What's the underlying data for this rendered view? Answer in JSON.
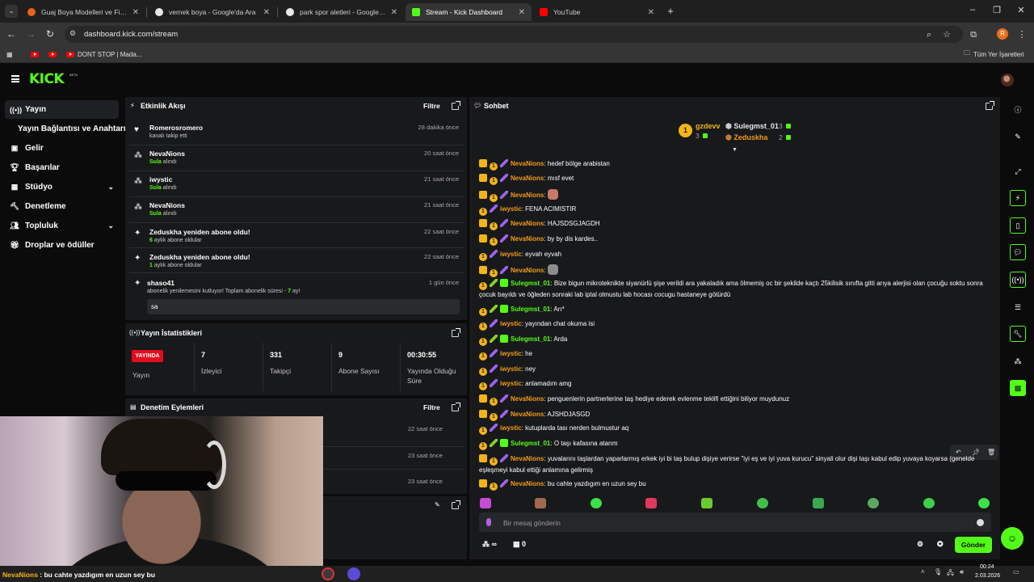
{
  "browser": {
    "tabs": [
      {
        "title": "Guaj Boya Modelleri ve Fiyatları",
        "favicon_color": "#e8631c"
      },
      {
        "title": "vernek boya - Google'da Ara",
        "favicon_color": "#e8e8e8"
      },
      {
        "title": "park spor aletleri - Google'da Ara",
        "favicon_color": "#e8e8e8"
      },
      {
        "title": "Stream - Kick Dashboard",
        "favicon_color": "#53fc18"
      },
      {
        "title": "YouTube",
        "favicon_color": "#ff0000"
      }
    ],
    "url": "dashboard.kick.com/stream",
    "profile_initial": "R",
    "bookmarks": {
      "item": "DONT STOP | Mada...",
      "all_label": "Tüm Yer İşaretleri"
    }
  },
  "app": {
    "logo": "KICK",
    "logo_badge": "BETA",
    "accent": "#53fc18"
  },
  "sidebar": {
    "items": [
      {
        "label": "Yayın",
        "icon": "broadcast-icon"
      },
      {
        "label": "Yayın Bağlantısı ve Anahtarı"
      },
      {
        "label": "Gelir",
        "icon": "revenue-icon"
      },
      {
        "label": "Başarılar",
        "icon": "trophy-icon"
      },
      {
        "label": "Stüdyo",
        "icon": "studio-icon"
      },
      {
        "label": "Denetleme",
        "icon": "hammer-icon"
      },
      {
        "label": "Topluluk",
        "icon": "community-icon"
      },
      {
        "label": "Droplar ve ödüller",
        "icon": "drops-icon"
      }
    ]
  },
  "activity": {
    "title": "Etkinlik Akışı",
    "filter": "Filtre",
    "events": [
      {
        "name": "Romerosromero",
        "sub": "kanalı takip etti",
        "time": "28 dakika önce",
        "icon": "heart-icon"
      },
      {
        "name": "NevaNions",
        "sub_hl": "Sula",
        "sub": " alındı",
        "time": "20 saat önce",
        "icon": "drops-icon"
      },
      {
        "name": "iwystic",
        "sub_hl": "Sula",
        "sub": " alındı",
        "time": "21 saat önce",
        "icon": "drops-icon"
      },
      {
        "name": "NevaNions",
        "sub_hl": "Sula",
        "sub": " alındı",
        "time": "21 saat önce",
        "icon": "drops-icon"
      },
      {
        "name": "Zeduskha yeniden abone oldu!",
        "sub_hl": "6",
        "sub": " aylık abone oldular",
        "time": "22 saat önce",
        "icon": "sparkle-icon"
      },
      {
        "name": "Zeduskha yeniden abone oldu!",
        "sub_hl": "1",
        "sub": " aylık abone oldular",
        "time": "22 saat önce",
        "icon": "sparkle-icon"
      },
      {
        "name": "shaso41",
        "sub": "abonelik yenilemesini kutluyor! Toplam abonelik süresi - ",
        "sub_hl2": "7",
        "sub_tail": " ay!",
        "time": "1 gün önce",
        "icon": "sparkle-icon",
        "message": "sa"
      }
    ]
  },
  "stats": {
    "title": "Yayın İstatistikleri",
    "live_badge": "YAYINDA",
    "live_label": "Yayın",
    "items": [
      {
        "value": "7",
        "label": "İzleyici"
      },
      {
        "value": "331",
        "label": "Takipçi"
      },
      {
        "value": "9",
        "label": "Abone Sayısı"
      },
      {
        "value": "00:30:55",
        "label": "Yayında Olduğu Süre"
      }
    ]
  },
  "moderation": {
    "title": "Denetim Eylemleri",
    "filter": "Filtre",
    "times": [
      "22 saat önce",
      "23 saat önce",
      "23 saat önce"
    ]
  },
  "chat": {
    "title": "Sohbet",
    "leaderboard": {
      "first": {
        "name": "gzdevv",
        "count": "3",
        "rank": "1"
      },
      "second": {
        "name": "Sulegmst_01",
        "count": "3"
      },
      "third": {
        "name": "Zeduskha",
        "count": "2"
      }
    },
    "messages": [
      {
        "badges": [
          "crown",
          "sub",
          "pen"
        ],
        "user": "NevaNions",
        "color": "#f29b1b",
        "text": "hedef bölge arabistan"
      },
      {
        "badges": [
          "crown",
          "sub",
          "pen"
        ],
        "user": "NevaNions",
        "color": "#f29b1b",
        "text": "mısf evet"
      },
      {
        "badges": [
          "crown",
          "sub",
          "pen"
        ],
        "user": "NevaNions",
        "color": "#f29b1b",
        "text": "",
        "emote": "#c9776a"
      },
      {
        "badges": [
          "sub",
          "pen"
        ],
        "user": "iwystic",
        "color": "#f29b1b",
        "text": "FENA ACIMISTIR"
      },
      {
        "badges": [
          "crown",
          "sub",
          "pen"
        ],
        "user": "NevaNions",
        "color": "#f29b1b",
        "text": "HAJSDSGJAGDH"
      },
      {
        "badges": [
          "crown",
          "sub",
          "pen"
        ],
        "user": "NevaNions",
        "color": "#f29b1b",
        "text": "by by dis kardes.."
      },
      {
        "badges": [
          "sub",
          "pen"
        ],
        "user": "iwystic",
        "color": "#f29b1b",
        "text": "eyvah eyvah"
      },
      {
        "badges": [
          "crown",
          "sub",
          "pen"
        ],
        "user": "NevaNions",
        "color": "#f29b1b",
        "text": "",
        "emote": "#8c8c8c"
      },
      {
        "badges": [
          "sub",
          "peng",
          "gift"
        ],
        "user": "Sulegmst_01",
        "color": "#53fc18",
        "text": "Bize bigun mikroteknikte siyanürlü şişe verildi ara yakaladık ama ölmemiş oc bir şekilde kaçtı 25kilisik sınıfta gitti arıya alerjisi olan çocuğu soktu sonra çocuk bayıldı ve öğleden sonraki lab iptal olmustu lab hocası cocugu hastaneye götürdü",
        "wrap": true
      },
      {
        "badges": [
          "sub",
          "peng",
          "gift"
        ],
        "user": "Sulegmst_01",
        "color": "#53fc18",
        "text": "Arı*"
      },
      {
        "badges": [
          "sub",
          "pen"
        ],
        "user": "iwystic",
        "color": "#f29b1b",
        "text": "yayından chat okuma isi"
      },
      {
        "badges": [
          "sub",
          "peng",
          "gift"
        ],
        "user": "Sulegmst_01",
        "color": "#53fc18",
        "text": "Arda"
      },
      {
        "badges": [
          "sub",
          "pen"
        ],
        "user": "iwystic",
        "color": "#f29b1b",
        "text": "he"
      },
      {
        "badges": [
          "sub",
          "pen"
        ],
        "user": "iwystic",
        "color": "#f29b1b",
        "text": "ney"
      },
      {
        "badges": [
          "sub",
          "pen"
        ],
        "user": "iwystic",
        "color": "#f29b1b",
        "text": "anlamadım amg"
      },
      {
        "badges": [
          "crown",
          "sub",
          "pen"
        ],
        "user": "NevaNions",
        "color": "#f29b1b",
        "text": "penguenlerin partnerlerine taş hediye ederek evlenme teklifi ettiğini biliyor muydunuz"
      },
      {
        "badges": [
          "crown",
          "sub",
          "pen"
        ],
        "user": "NevaNions",
        "color": "#f29b1b",
        "text": "AJSHDJASGD"
      },
      {
        "badges": [
          "sub",
          "pen"
        ],
        "user": "iwystic",
        "color": "#f29b1b",
        "text": "kutuplarda tası nerden bulmustur aq"
      },
      {
        "badges": [
          "sub",
          "peng",
          "gift"
        ],
        "user": "Sulegmst_01",
        "color": "#53fc18",
        "text": "O taşı kafasına atarım"
      },
      {
        "badges": [
          "crown",
          "sub",
          "pen"
        ],
        "user": "NevaNions",
        "color": "#f29b1b",
        "text": "yuvalarını taşlardan yaparlarmış erkek iyi bi taş bulup dişiye verirse \"iyi eş ve iyi yuva kurucu\" sinyali olur dişi taşı kabul edip yuvaya koyarsa (genelde eşleşmeyi kabul ettiği anlamına gelirmiş",
        "wrap": true
      },
      {
        "badges": [
          "crown",
          "sub",
          "pen"
        ],
        "user": "NevaNions",
        "color": "#f29b1b",
        "text": "bu cahte yazdıgım en uzun sey bu"
      }
    ],
    "input_placeholder": "Bir mesaj gönderin",
    "send_label": "Gönder",
    "followers_mode": "∞",
    "slowmode_count": "0"
  },
  "taskbar": {
    "ticker_user": "NevaNions",
    "ticker_text": " : bu cahte yazdıgım en uzun sey bu",
    "time": "00:24",
    "date": "2.03.2026"
  }
}
